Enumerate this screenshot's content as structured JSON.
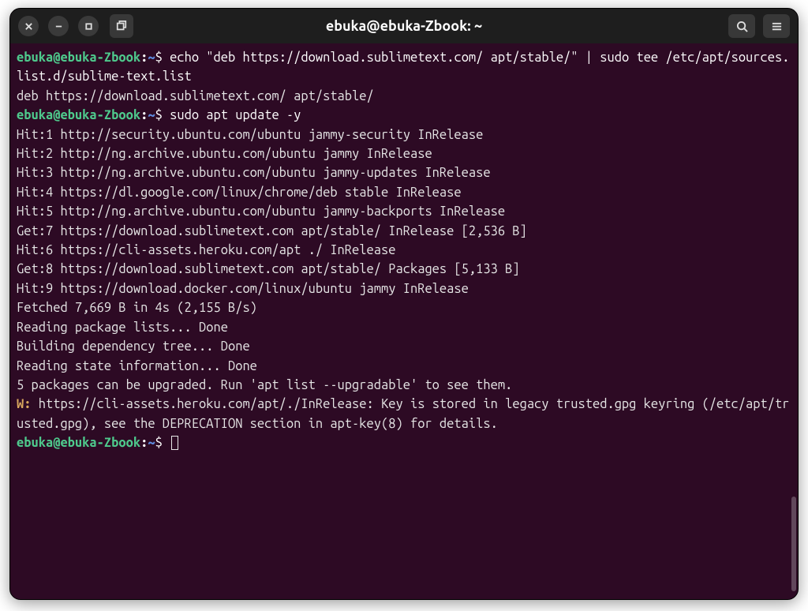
{
  "window": {
    "title": "ebuka@ebuka-Zbook: ~"
  },
  "prompt": {
    "user": "ebuka@ebuka-Zbook",
    "path": "~",
    "symbol": "$"
  },
  "lines": {
    "cmd1": "echo \"deb https://download.sublimetext.com/ apt/stable/\" | sudo tee /etc/apt/sources.list.d/sublime-text.list",
    "out1": "deb https://download.sublimetext.com/ apt/stable/",
    "cmd2": "sudo apt update -y",
    "out2": "Hit:1 http://security.ubuntu.com/ubuntu jammy-security InRelease",
    "out3": "Hit:2 http://ng.archive.ubuntu.com/ubuntu jammy InRelease",
    "out4": "Hit:3 http://ng.archive.ubuntu.com/ubuntu jammy-updates InRelease",
    "out5": "Hit:4 https://dl.google.com/linux/chrome/deb stable InRelease",
    "out6": "Hit:5 http://ng.archive.ubuntu.com/ubuntu jammy-backports InRelease",
    "out7": "Get:7 https://download.sublimetext.com apt/stable/ InRelease [2,536 B]",
    "out8": "Hit:6 https://cli-assets.heroku.com/apt ./ InRelease",
    "out9": "Get:8 https://download.sublimetext.com apt/stable/ Packages [5,133 B]",
    "out10": "Hit:9 https://download.docker.com/linux/ubuntu jammy InRelease",
    "out11": "Fetched 7,669 B in 4s (2,155 B/s)",
    "out12": "Reading package lists... Done",
    "out13": "Building dependency tree... Done",
    "out14": "Reading state information... Done",
    "out15": "5 packages can be upgraded. Run 'apt list --upgradable' to see them.",
    "warn_prefix": "W: ",
    "warn_text": "https://cli-assets.heroku.com/apt/./InRelease: Key is stored in legacy trusted.gpg keyring (/etc/apt/trusted.gpg), see the DEPRECATION section in apt-key(8) for details."
  }
}
